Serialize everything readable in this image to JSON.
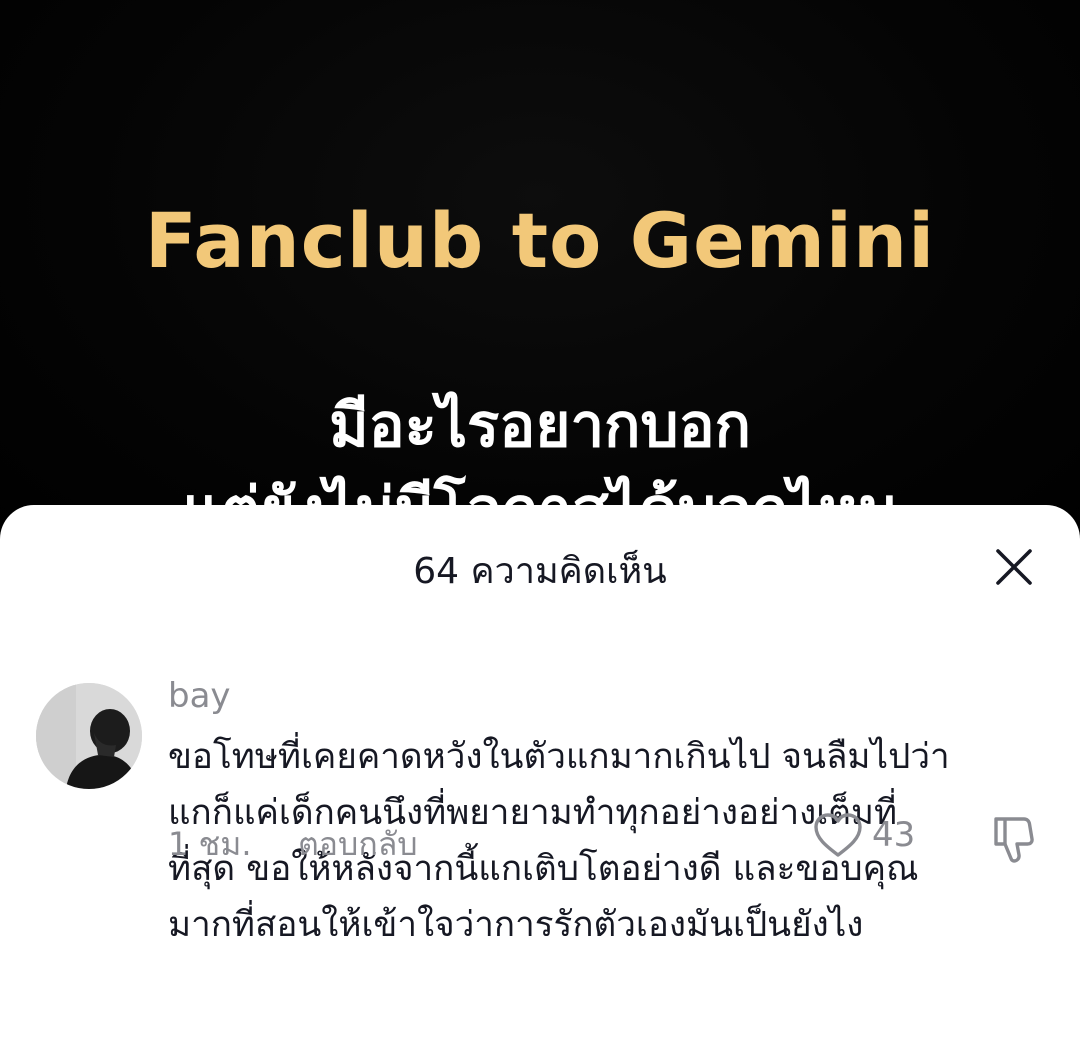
{
  "video": {
    "title": "Fanclub to Gemini",
    "line1": "มีอะไรอยากบอก",
    "line2": "แต่ยังไม่มีโอกาสได้บอกไหม"
  },
  "comments_panel": {
    "header": "64 ความคิดเห็น",
    "close_icon": "close-icon"
  },
  "comment": {
    "username": "bay",
    "text_lines": [
      "ขอโทษที่เคยคาดหวังในตัวแกมากเกินไป จนลืมไปว่า",
      "แกก็แค่เด็กคนนึงที่พยายามทำทุกอย่างอย่างเต็มที่",
      "ที่สุด ขอให้หลังจากนี้แกเติบโตอย่างดี และขอบคุณ",
      "มากที่สอนให้เข้าใจว่าการรักตัวเองมันเป็นยังไง"
    ],
    "time": "1 ชม.",
    "reply_label": "ตอบกลับ",
    "like_count": "43",
    "like_icon": "heart-icon",
    "dislike_icon": "thumbs-down-icon"
  },
  "colors": {
    "title_gold": "#f2c879",
    "text_primary": "#161823",
    "text_secondary": "#8a8b91"
  }
}
